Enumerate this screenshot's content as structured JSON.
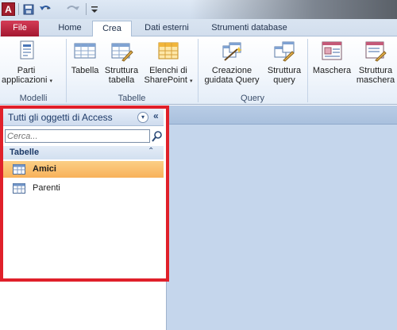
{
  "app": {
    "icon_letter": "A",
    "quick_access": {
      "save_icon": "save-icon",
      "undo_icon": "undo-icon",
      "redo_icon": "redo-icon",
      "customize_icon": "customize-qat-icon"
    }
  },
  "ribbon_tabs": [
    {
      "label": "File",
      "active": false
    },
    {
      "label": "Home",
      "active": false
    },
    {
      "label": "Crea",
      "active": true
    },
    {
      "label": "Dati esterni",
      "active": false
    },
    {
      "label": "Strumenti database",
      "active": false
    }
  ],
  "ribbon_groups": {
    "modelli": {
      "label": "Modelli",
      "buttons": [
        {
          "line1": "Parti",
          "line2": "applicazioni",
          "dropdown": "▾",
          "icon": "application-parts-icon"
        }
      ]
    },
    "tabelle": {
      "label": "Tabelle",
      "buttons": [
        {
          "line1": "Tabella",
          "line2": "",
          "icon": "table-icon"
        },
        {
          "line1": "Struttura",
          "line2": "tabella",
          "icon": "table-design-icon"
        },
        {
          "line1": "Elenchi di",
          "line2": "SharePoint",
          "dropdown": "▾",
          "icon": "sharepoint-lists-icon"
        }
      ]
    },
    "query": {
      "label": "Query",
      "buttons": [
        {
          "line1": "Creazione",
          "line2": "guidata Query",
          "icon": "query-wizard-icon"
        },
        {
          "line1": "Struttura",
          "line2": "query",
          "icon": "query-design-icon"
        }
      ]
    },
    "maschere": {
      "buttons": [
        {
          "line1": "Maschera",
          "line2": "",
          "icon": "form-icon"
        },
        {
          "line1": "Struttura",
          "line2": "maschera",
          "icon": "form-design-icon"
        }
      ]
    }
  },
  "nav_pane": {
    "title": "Tutti gli oggetti di Access",
    "dropdown_glyph": "▾",
    "collapse_glyph": "«",
    "search_placeholder": "Cerca...",
    "group": {
      "label": "Tabelle",
      "collapse_glyph": "⌃"
    },
    "items": [
      {
        "label": "Amici",
        "selected": true
      },
      {
        "label": "Parenti",
        "selected": false
      }
    ]
  },
  "colors": {
    "highlight_border": "#e0202a",
    "selected_item": "#f8b15a",
    "file_tab": "#b82340",
    "workspace": "#c5d6ec"
  }
}
